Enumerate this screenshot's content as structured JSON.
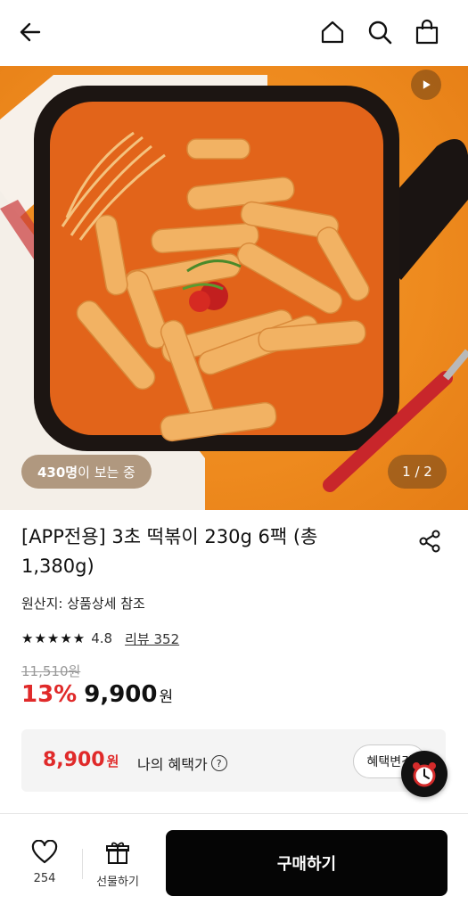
{
  "header": {
    "back_icon": "arrow-left-icon",
    "home_icon": "home-icon",
    "search_icon": "search-icon",
    "cart_icon": "shopping-bag-icon"
  },
  "hero": {
    "viewer_count": "430명",
    "viewer_suffix": "이 보는 중",
    "page_indicator": "1 / 2",
    "play_icon": "play-icon"
  },
  "product": {
    "title": "[APP전용] 3초 떡볶이 230g 6팩 (총 1,380g)",
    "origin": "원산지: 상품상세 참조",
    "rating_stars": "★★★★★",
    "rating": "4.8",
    "review_link": "리뷰 352",
    "original_price": "11,510원",
    "discount": "13%",
    "price": "9,900",
    "price_unit": "원"
  },
  "benefit": {
    "price": "8,900",
    "price_unit": "원",
    "label": "나의 혜택가",
    "help_icon": "?",
    "change_button": "혜택변경"
  },
  "bottom_bar": {
    "like_count": "254",
    "gift_label": "선물하기",
    "buy_label": "구매하기"
  },
  "colors": {
    "accent_red": "#e02a2a",
    "buy_button": "#050505",
    "hero_orange": "#ee8a1e"
  }
}
